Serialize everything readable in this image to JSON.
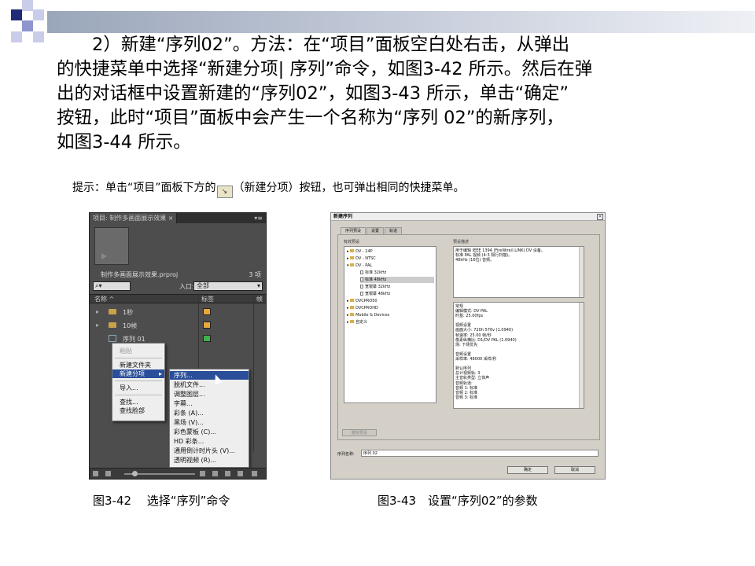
{
  "colors": {
    "accent_dark": "#1f2a78",
    "accent_mid": "#8f96cf",
    "accent_light": "#c9cde9",
    "bar_gradient": [
      "#9aa6ba",
      "#eef0f5"
    ]
  },
  "body_text": "　　2）新建“序列02”。方法：在“项目”面板空白处右击，从弹出\n的快捷菜单中选择“新建分项| 序列”命令，如图3-42 所示。然后在弹\n出的对话框中设置新建的“序列02”，如图3-43 所示，单击“确定”\n按钮，此时“项目”面板中会产生一个名称为“序列 02”的新序列，\n如图3-44 所示。",
  "tip": {
    "before": "提示：单击“项目”面板下方的",
    "icon": "new-item-icon",
    "after": "（新建分项）按钮，也可弹出相同的快捷菜单。"
  },
  "caption_left": "图3-42　 选择“序列”命令",
  "caption_right": "图3-43　设置“序列02”的参数",
  "project_panel": {
    "tab": "项目: 制作多画面展示效果 ×",
    "project_file": "制作多画面展示效果.prproj",
    "item_count": "3 项",
    "search_icon": "search-icon",
    "in_label": "入口:",
    "in_value": "全部",
    "columns": [
      "名称 ^",
      "标签",
      "帧"
    ],
    "rows": [
      {
        "name": "1秒",
        "type": "folder",
        "color": "#e8a83c"
      },
      {
        "name": "10帧",
        "type": "folder",
        "color": "#e8a83c"
      },
      {
        "name": "序列 01",
        "type": "sequence",
        "color": "#3fb24a"
      }
    ],
    "context_menu": [
      "粘贴",
      "新建文件夹",
      "新建分项",
      "导入...",
      "查找...",
      "查找脸部"
    ],
    "submenu": [
      "序列...",
      "脱机文件...",
      "调整图层...",
      "字幕...",
      "彩条 (A)...",
      "黑场 (V)...",
      "彩色蒙板 (C)...",
      "HD 彩条...",
      "通用倒计时片头 (V)...",
      "透明视频 (R)..."
    ]
  },
  "dialog": {
    "title": "新建序列",
    "close": "×",
    "tabs": [
      "序列预设",
      "设置",
      "轨道"
    ],
    "presets_label": "有效预设",
    "desc_label": "预设描述",
    "tree": [
      {
        "label": "DV - 24P",
        "type": "folder",
        "level": 0
      },
      {
        "label": "DV - NTSC",
        "type": "folder",
        "level": 0
      },
      {
        "label": "DV - PAL",
        "type": "folder",
        "level": 0
      },
      {
        "label": "标准 32kHz",
        "type": "file",
        "level": 1
      },
      {
        "label": "标准 48kHz",
        "type": "file",
        "level": 1,
        "selected": true
      },
      {
        "label": "宽银幕 32kHz",
        "type": "file",
        "level": 1
      },
      {
        "label": "宽银幕 48kHz",
        "type": "file",
        "level": 1
      },
      {
        "label": "DVCPRO50",
        "type": "folder",
        "level": 0
      },
      {
        "label": "DVCPROHD",
        "type": "folder",
        "level": 0
      },
      {
        "label": "Mobile & Devices",
        "type": "folder",
        "level": 0
      },
      {
        "label": "自定义",
        "type": "folder",
        "level": 0
      }
    ],
    "description": "用于编辑 IEEE 1394 (FireWire/i.LINK) DV 设备。\n标准 PAL 视频 (4:3 隔行扫描)。\n48kHz (16位) 音频。",
    "settings": "常规\n编辑模式: DV PAL\n时基: 25.00fps\n\n视频设置\n画面大小: 720h 576v (1.0940)\n帧速率: 25.00 帧/秒\n像素纵横比: D1/DV PAL (1.0940)\n场: 下场优先\n\n音频设置\n采样率: 48000 采样/秒\n\n默认序列\n总计视频轨: 3\n主音轨类型: 立体声\n音频轨道:\n音频 1: 标准\n音频 2: 标准\n音频 3: 标准",
    "delete_preset": "删除预设",
    "name_label": "序列名称:",
    "name_value": "序列 02",
    "ok": "确定",
    "cancel": "取消"
  }
}
